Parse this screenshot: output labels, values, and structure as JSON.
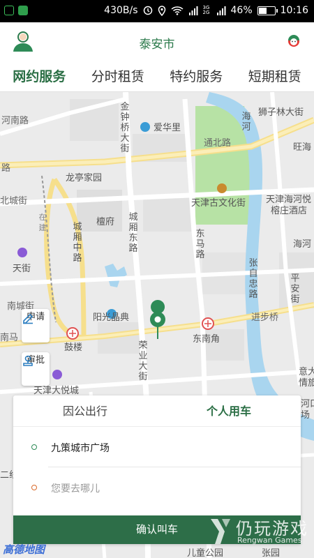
{
  "status_bar": {
    "speed": "430B/s",
    "signal_label": "3G 2G",
    "battery": "46%",
    "battery_level": 0.46,
    "time": "10:16"
  },
  "header": {
    "title": "泰安市",
    "avatar_icon": "user-avatar-icon",
    "service_icon": "customer-service-icon",
    "accent_color": "#2b7a4b"
  },
  "tabs": [
    {
      "label": "网约服务",
      "active": true
    },
    {
      "label": "分时租赁",
      "active": false
    },
    {
      "label": "特约服务",
      "active": false
    },
    {
      "label": "短期租赁",
      "active": false
    }
  ],
  "map": {
    "labels": {
      "hongqiao": "金钟桥大街",
      "aihuali": "爱华里",
      "shizilin": "狮子林大街",
      "haihe": "海河",
      "wangpu": "旺海",
      "tongbei": "通北路",
      "huanhe": "河南路",
      "lu": "路",
      "longting": "龙亭家园",
      "chengxiang_n": "北城街",
      "tianjin_wenhua": "天津古文化街",
      "haihe_yue": "天津海河悦",
      "rongzhuang": "榕庄酒店",
      "tanfu": "檀府",
      "chengxiangdong": "城厢东路",
      "chengxiangzhong": "城厢中路",
      "dongma": "东马路",
      "zhangzizhong": "张自忠路",
      "haihe2": "海河",
      "tianjie": "天街",
      "pingan": "平安街",
      "nanchengjie": "南城街",
      "yangguang": "阳光晶典",
      "jinbuqiao": "进步桥",
      "nanma": "南马",
      "gulou": "鼓楼",
      "dongnanjiao": "东南角",
      "rongye": "荣业大街",
      "yueda": "意大",
      "qingsuo": "情旅",
      "tianjin_dayue": "天津大悦城",
      "he_kou": "河口",
      "chang": "场",
      "er_tiao": "二线",
      "zaijian": "在建",
      "ertong_park": "儿童公园",
      "zhangyuan": "张园"
    },
    "side_buttons": [
      {
        "label": "申请",
        "icon": "pen-icon"
      },
      {
        "label": "审批",
        "icon": "stamp-icon"
      }
    ],
    "locate_icon": "locate-icon",
    "pin_icon": "map-pin-icon",
    "metro_icon": "metro-icon"
  },
  "card": {
    "segments": [
      {
        "label": "因公出行",
        "active": false
      },
      {
        "label": "个人用车",
        "active": true
      }
    ],
    "origin": {
      "text": "九策城市广场",
      "dot_color": "#2e8b57"
    },
    "destination": {
      "placeholder": "您要去哪儿",
      "dot_color": "#d96a2b"
    },
    "confirm_label": "确认叫车",
    "confirm_color": "#2d6e48"
  },
  "map_logo": "高德地图",
  "watermark": {
    "cn": "仍玩游戏",
    "en": "Rengwan Games"
  }
}
